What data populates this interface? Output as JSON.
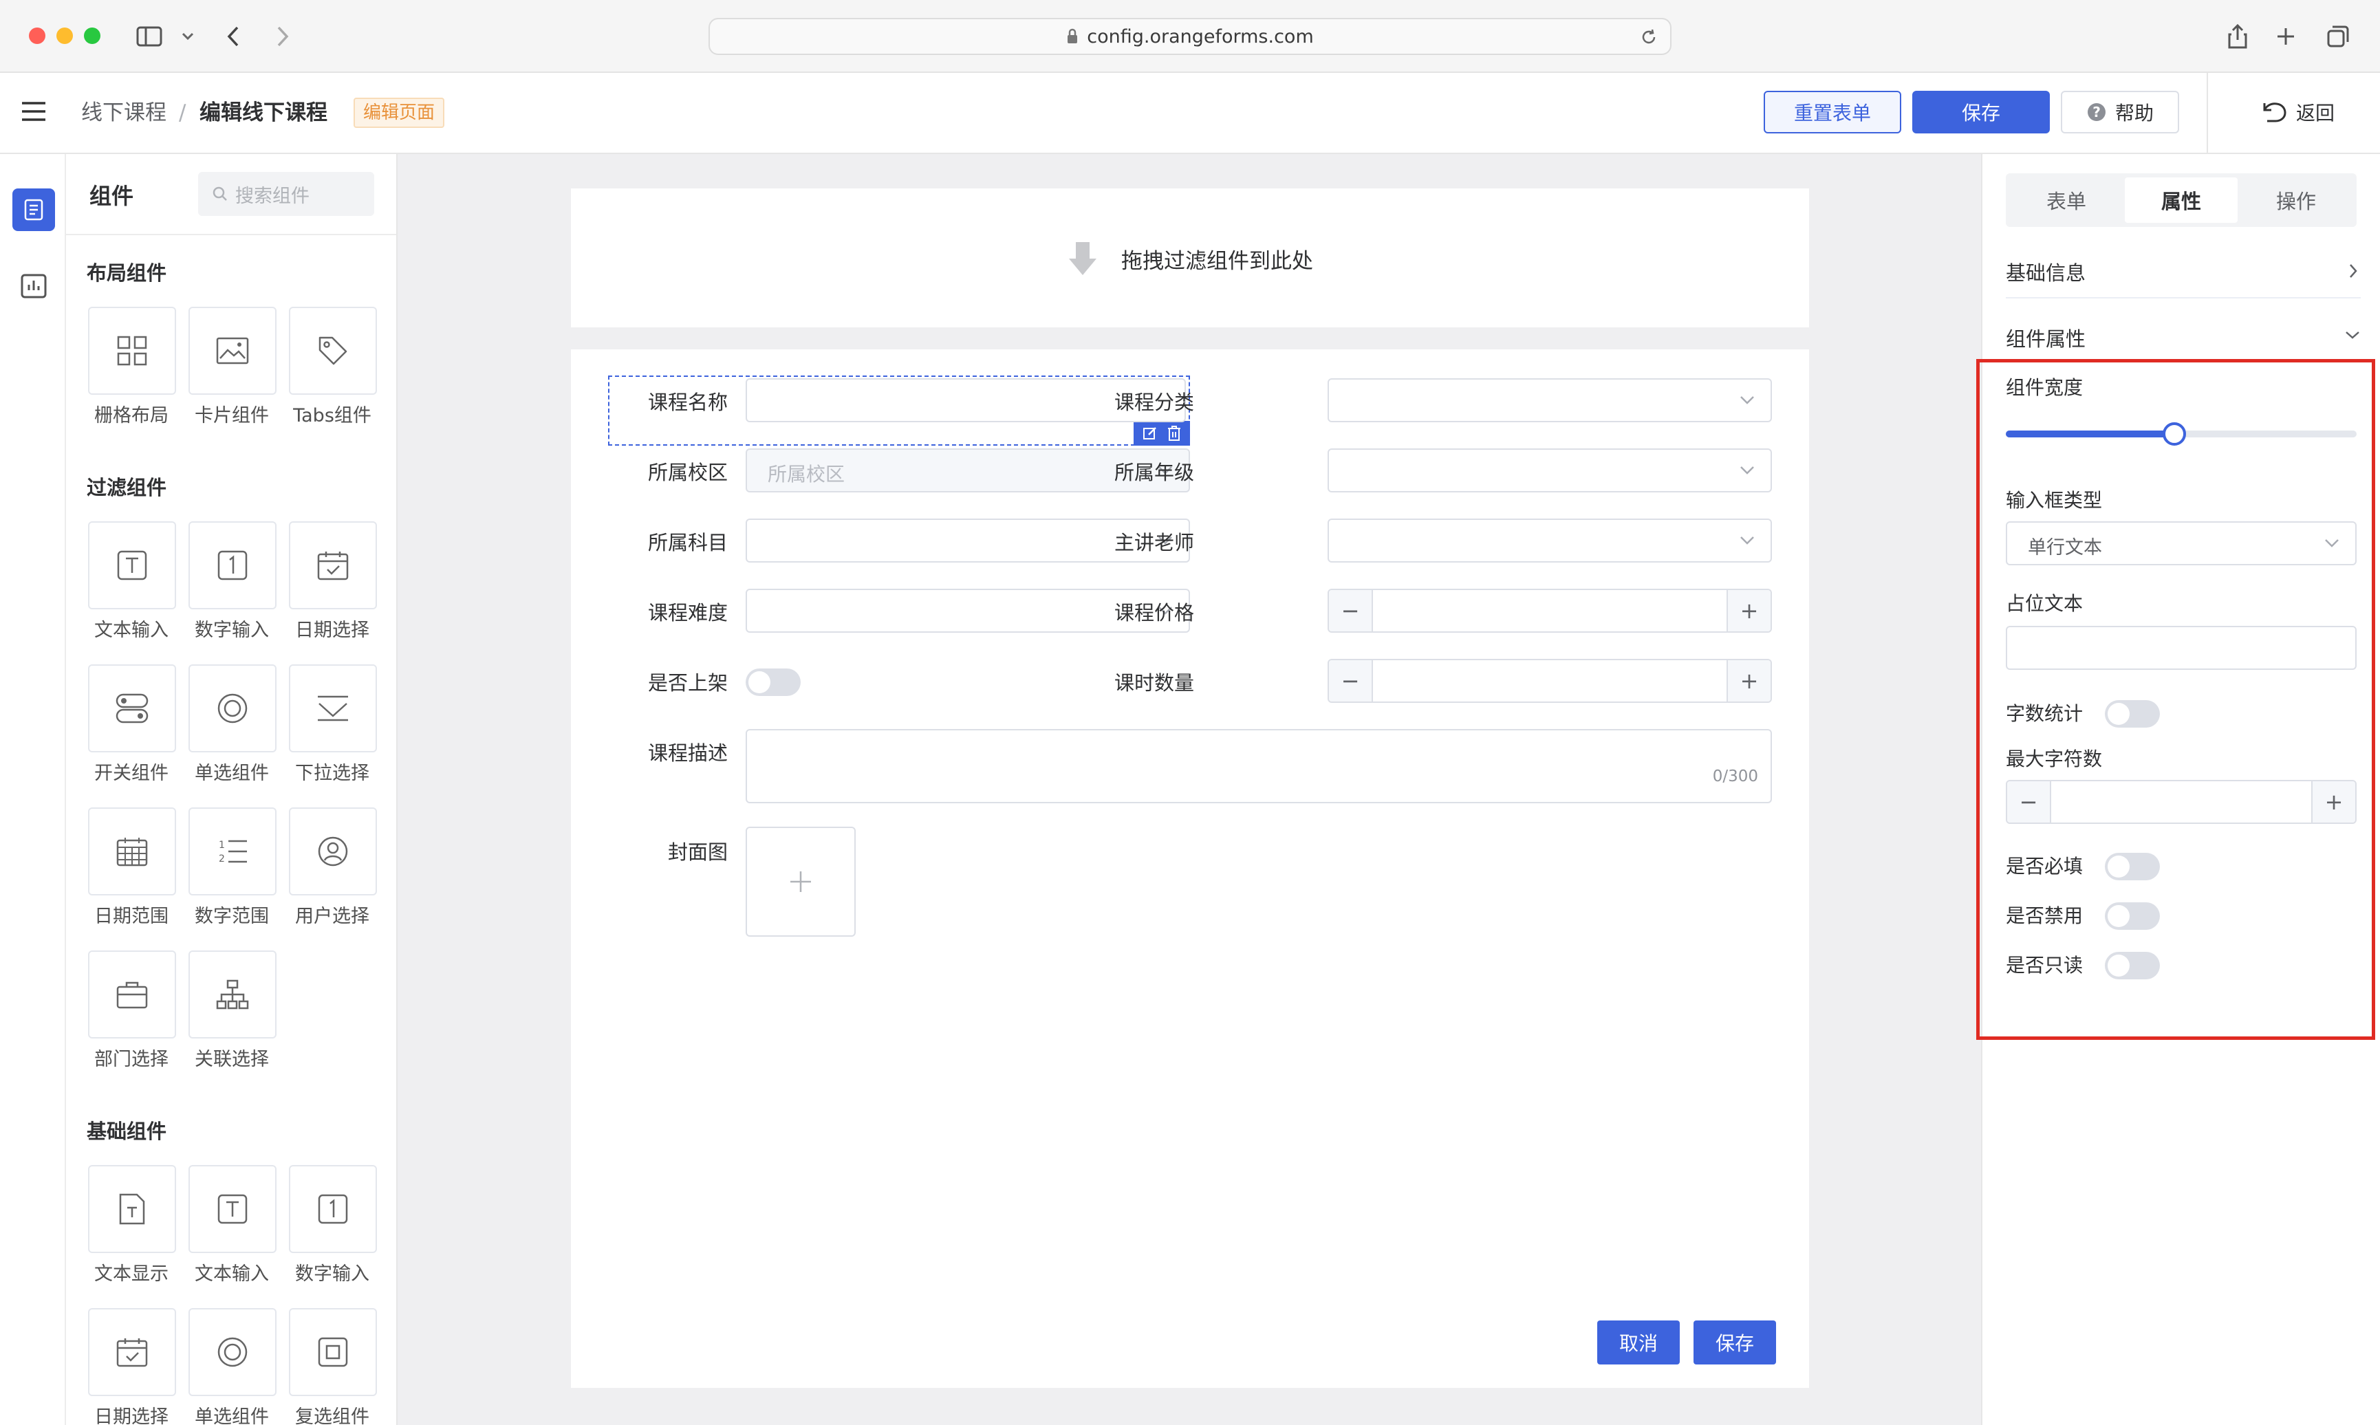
{
  "browser": {
    "url": "config.orangeforms.com",
    "traffic_colors": [
      "#ff5f57",
      "#febc2e",
      "#28c840"
    ]
  },
  "header": {
    "breadcrumb_parent": "线下课程",
    "breadcrumb_sep": "/",
    "breadcrumb_current": "编辑线下课程",
    "page_tag": "编辑页面",
    "reset_label": "重置表单",
    "save_label": "保存",
    "help_label": "帮助",
    "back_label": "返回"
  },
  "components": {
    "title": "组件",
    "search_placeholder": "搜索组件",
    "sections": [
      {
        "title": "布局组件",
        "items": [
          {
            "label": "栅格布局",
            "icon": "grid-icon"
          },
          {
            "label": "卡片组件",
            "icon": "image-card-icon"
          },
          {
            "label": "Tabs组件",
            "icon": "tag-icon"
          }
        ]
      },
      {
        "title": "过滤组件",
        "items": [
          {
            "label": "文本输入",
            "icon": "text-icon"
          },
          {
            "label": "数字输入",
            "icon": "number-icon"
          },
          {
            "label": "日期选择",
            "icon": "calendar-check-icon"
          },
          {
            "label": "开关组件",
            "icon": "switch-icon"
          },
          {
            "label": "单选组件",
            "icon": "radio-icon"
          },
          {
            "label": "下拉选择",
            "icon": "dropdown-icon"
          },
          {
            "label": "日期范围",
            "icon": "calendar-grid-icon"
          },
          {
            "label": "数字范围",
            "icon": "ordered-list-icon"
          },
          {
            "label": "用户选择",
            "icon": "user-icon"
          },
          {
            "label": "部门选择",
            "icon": "briefcase-icon"
          },
          {
            "label": "关联选择",
            "icon": "org-tree-icon"
          }
        ]
      },
      {
        "title": "基础组件",
        "items": [
          {
            "label": "文本显示",
            "icon": "document-text-icon"
          },
          {
            "label": "文本输入",
            "icon": "text-icon"
          },
          {
            "label": "数字输入",
            "icon": "number-icon"
          },
          {
            "label": "日期选择",
            "icon": "calendar-check-icon"
          },
          {
            "label": "单选组件",
            "icon": "radio-icon"
          },
          {
            "label": "复选组件",
            "icon": "checkbox-icon"
          }
        ]
      }
    ]
  },
  "dropzone": {
    "text": "拖拽过滤组件到此处"
  },
  "form": {
    "fields": {
      "course_name": "课程名称",
      "course_category": "课程分类",
      "campus": "所属校区",
      "campus_placeholder": "所属校区",
      "grade": "所属年级",
      "subject": "所属科目",
      "teacher": "主讲老师",
      "difficulty": "课程难度",
      "price": "课程价格",
      "on_shelf": "是否上架",
      "hours": "课时数量",
      "description": "课程描述",
      "desc_counter": "0/300",
      "cover": "封面图"
    },
    "cancel_label": "取消",
    "save_label": "保存"
  },
  "right_panel": {
    "tabs": [
      {
        "label": "表单",
        "active": false
      },
      {
        "label": "属性",
        "active": true
      },
      {
        "label": "操作",
        "active": false
      }
    ],
    "basic_info": "基础信息",
    "component_props": "组件属性",
    "width_label": "组件宽度",
    "width_value": 0.48,
    "input_type_label": "输入框类型",
    "input_type_value": "单行文本",
    "placeholder_label": "占位文本",
    "word_count_label": "字数统计",
    "max_chars_label": "最大字符数",
    "required_label": "是否必填",
    "disabled_label": "是否禁用",
    "readonly_label": "是否只读"
  },
  "colors": {
    "primary": "#3d63dd",
    "tag_orange": "#f0a04b",
    "highlight_red": "#e02b23"
  }
}
